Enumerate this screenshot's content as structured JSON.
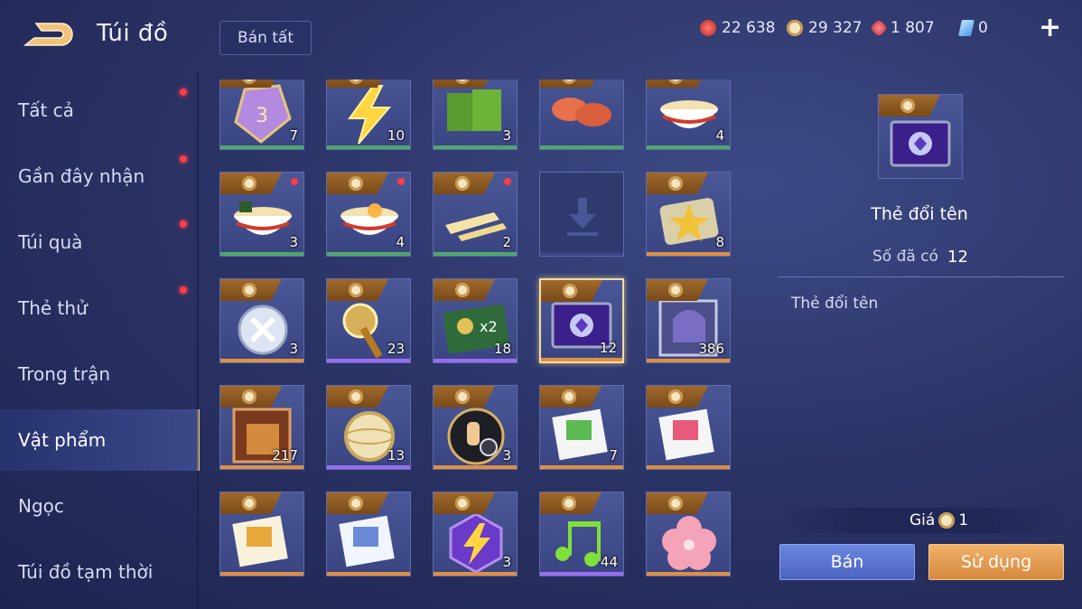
{
  "header": {
    "title": "Túi đồ",
    "sell_all_label": "Bán tất",
    "currencies": [
      {
        "icon": "red-crystal-icon",
        "value": "22 638",
        "color": "#d9413b"
      },
      {
        "icon": "gold-coin-icon",
        "value": "29 327",
        "color": "#e7c37a"
      },
      {
        "icon": "ruby-gem-icon",
        "value": "1 807",
        "color": "#e0505a"
      },
      {
        "icon": "blue-voucher-icon",
        "value": "0",
        "color": "#6fb9ff"
      }
    ],
    "add_icon": "plus-icon"
  },
  "sidebar": {
    "items": [
      {
        "label": "Tất cả",
        "notify": true
      },
      {
        "label": "Gần đây nhận",
        "notify": true
      },
      {
        "label": "Túi quà",
        "notify": true
      },
      {
        "label": "Thẻ thử",
        "notify": true
      },
      {
        "label": "Trong trận",
        "notify": false
      },
      {
        "label": "Vật phẩm",
        "notify": false,
        "active": true
      },
      {
        "label": "Ngọc",
        "notify": false
      },
      {
        "label": "Túi đồ tạm thời",
        "notify": false
      }
    ]
  },
  "grid": {
    "rows": [
      [
        {
          "icon": "dice-icon",
          "count": "7"
        },
        {
          "icon": "lightning-icon",
          "count": "10"
        },
        {
          "icon": "green-cards-icon",
          "count": "3"
        },
        {
          "icon": "meat-slices-icon",
          "count": ""
        },
        {
          "icon": "noodle-bowl-icon",
          "count": "4"
        }
      ],
      [
        {
          "icon": "ramen-bowl-icon",
          "count": "3",
          "new": true
        },
        {
          "icon": "egg-bowl-icon",
          "count": "4",
          "new": true
        },
        {
          "icon": "bamboo-shoots-icon",
          "count": "2",
          "new": true
        },
        {
          "icon": "download-icon",
          "count": ""
        },
        {
          "icon": "star-ticket-icon",
          "count": "8"
        }
      ],
      [
        {
          "icon": "silver-orb-icon",
          "count": "3"
        },
        {
          "icon": "golden-scepter-icon",
          "count": "23"
        },
        {
          "icon": "exp-card-x2-icon",
          "count": "18"
        },
        {
          "icon": "rename-card-icon",
          "count": "12",
          "selected": true
        },
        {
          "icon": "helmet-card-icon",
          "count": "386"
        }
      ],
      [
        {
          "icon": "gold-armor-icon",
          "count": "217"
        },
        {
          "icon": "gold-sphere-icon",
          "count": "13"
        },
        {
          "icon": "hand-check-icon",
          "count": "3"
        },
        {
          "icon": "green-book-icon",
          "count": "7"
        },
        {
          "icon": "pink-book-icon",
          "count": ""
        }
      ],
      [
        {
          "icon": "yellow-book-icon",
          "count": ""
        },
        {
          "icon": "blue-book-icon",
          "count": ""
        },
        {
          "icon": "purple-bolt-gem-icon",
          "count": "3"
        },
        {
          "icon": "music-notes-icon",
          "count": "44"
        },
        {
          "icon": "pink-flower-icon",
          "count": ""
        }
      ]
    ],
    "rarity_bars": [
      [
        "#4fa86a",
        "#4fa86a",
        "#4fa86a",
        "#4fa86a",
        "#4fa86a"
      ],
      [
        "#4fa86a",
        "#4fa86a",
        "#4fa86a",
        "#3a4582",
        "#e09040"
      ],
      [
        "#e09040",
        "#9a6cf0",
        "#9a6cf0",
        "#e09040",
        "#e09040"
      ],
      [
        "#e09040",
        "#9a6cf0",
        "#e09040",
        "#e09040",
        "#e09040"
      ],
      [
        "#e09040",
        "#e09040",
        "#e09040",
        "#9a6cf0",
        "#e09040"
      ]
    ]
  },
  "detail": {
    "name": "Thẻ đổi tên",
    "owned_label": "Số đã có",
    "owned_value": "12",
    "description": "Thẻ đổi tên",
    "price_label": "Giá",
    "price_value": "1",
    "sell_label": "Bán",
    "use_label": "Sử dụng"
  }
}
